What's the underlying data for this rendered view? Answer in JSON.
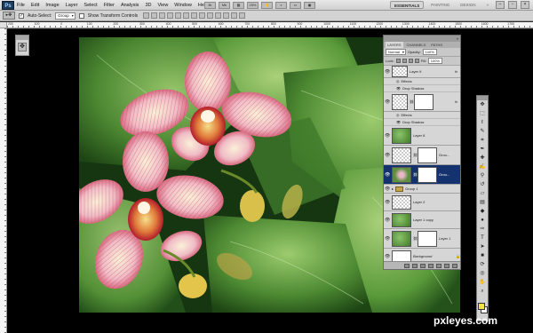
{
  "menubar": {
    "logo": "Ps",
    "items": [
      "File",
      "Edit",
      "Image",
      "Layer",
      "Select",
      "Filter",
      "Analysis",
      "3D",
      "View",
      "Window",
      "Help"
    ],
    "zoom": "25%",
    "workspaces": [
      "ESSENTIALS",
      "PAINTING",
      "DESIGN"
    ],
    "active_workspace": "ESSENTIALS"
  },
  "options": {
    "auto_select_label": "Auto-Select:",
    "auto_select_value": "Group",
    "transform_label": "Show Transform Controls"
  },
  "ruler": {
    "top_numbers": [
      "200",
      "100",
      "0",
      "100",
      "200",
      "300",
      "400",
      "500",
      "600",
      "700",
      "800",
      "900",
      "1000",
      "1100",
      "1200",
      "1300",
      "1400",
      "1500",
      "1600",
      "1700"
    ]
  },
  "layers_panel": {
    "tabs": [
      "LAYERS",
      "CHANNELS",
      "PATHS"
    ],
    "blend_mode": "Normal",
    "opacity_label": "Opacity:",
    "opacity_value": "100%",
    "lock_label": "Lock:",
    "fill_label": "Fill:",
    "fill_value": "100%",
    "layers": [
      {
        "name": "Layer 9",
        "thumb": "checker",
        "fx": true,
        "mask": false,
        "selected": false
      },
      {
        "sub": "Effects"
      },
      {
        "sub": "Drop Shadow"
      },
      {
        "name": "",
        "thumb": "checker",
        "fx": true,
        "mask": true,
        "selected": false
      },
      {
        "sub": "Effects"
      },
      {
        "sub": "Drop Shadow"
      },
      {
        "name": "Layer 8",
        "thumb": "green",
        "fx": false,
        "mask": false,
        "selected": false
      },
      {
        "name": "Grou...",
        "thumb": "checker",
        "fx": false,
        "mask": true,
        "selected": false
      },
      {
        "name": "Grou...",
        "thumb": "flower",
        "fx": false,
        "mask": true,
        "selected": true
      },
      {
        "group": "Group 1"
      },
      {
        "name": "Layer 2",
        "thumb": "checker",
        "fx": false,
        "mask": false,
        "selected": false
      },
      {
        "name": "Layer 1 copy",
        "thumb": "green",
        "fx": false,
        "mask": false,
        "selected": false
      },
      {
        "name": "Layer 1",
        "thumb": "green",
        "fx": false,
        "mask": true,
        "selected": false
      },
      {
        "name": "Background",
        "thumb": "white",
        "fx": false,
        "mask": false,
        "selected": false,
        "locked": true
      }
    ]
  },
  "watermark": "pxleyes.com",
  "colors": {
    "foreground": "#f3e24a",
    "background": "#ffffff",
    "selection": "#14336e"
  }
}
